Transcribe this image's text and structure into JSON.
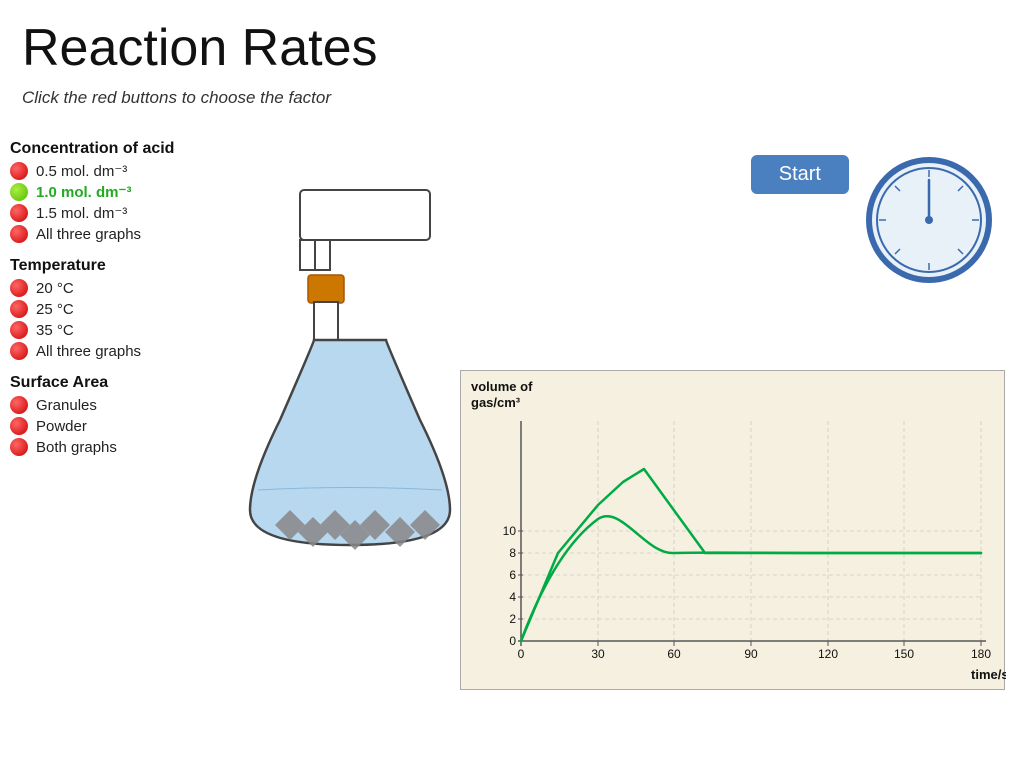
{
  "page": {
    "title": "Reaction Rates",
    "subtitle": "Click the red buttons to choose the factor"
  },
  "start_button": "Start",
  "sections": [
    {
      "id": "concentration",
      "label": "Concentration of acid",
      "options": [
        {
          "id": "conc-05",
          "text": "0.5 mol. dm⁻³",
          "active": false,
          "color": "red"
        },
        {
          "id": "conc-10",
          "text": "1.0 mol. dm⁻³",
          "active": true,
          "color": "green"
        },
        {
          "id": "conc-15",
          "text": "1.5 mol. dm⁻³",
          "active": false,
          "color": "red"
        },
        {
          "id": "conc-all",
          "text": "All three graphs",
          "active": false,
          "color": "red"
        }
      ]
    },
    {
      "id": "temperature",
      "label": "Temperature",
      "options": [
        {
          "id": "temp-20",
          "text": "20 °C",
          "active": false,
          "color": "red"
        },
        {
          "id": "temp-25",
          "text": "25 °C",
          "active": false,
          "color": "red"
        },
        {
          "id": "temp-35",
          "text": "35 °C",
          "active": false,
          "color": "red"
        },
        {
          "id": "temp-all",
          "text": "All three graphs",
          "active": false,
          "color": "red"
        }
      ]
    },
    {
      "id": "surface",
      "label": "Surface Area",
      "options": [
        {
          "id": "surf-gran",
          "text": "Granules",
          "active": false,
          "color": "red"
        },
        {
          "id": "surf-pow",
          "text": "Powder",
          "active": false,
          "color": "red"
        },
        {
          "id": "surf-both",
          "text": "Both graphs",
          "active": false,
          "color": "red"
        }
      ]
    }
  ],
  "graph": {
    "y_label": "volume of\ngas/cm³",
    "x_label": "time/s",
    "y_ticks": [
      "10",
      "8",
      "6",
      "4",
      "2",
      "0"
    ],
    "x_ticks": [
      "0",
      "30",
      "60",
      "90",
      "120",
      "150",
      "180"
    ]
  }
}
